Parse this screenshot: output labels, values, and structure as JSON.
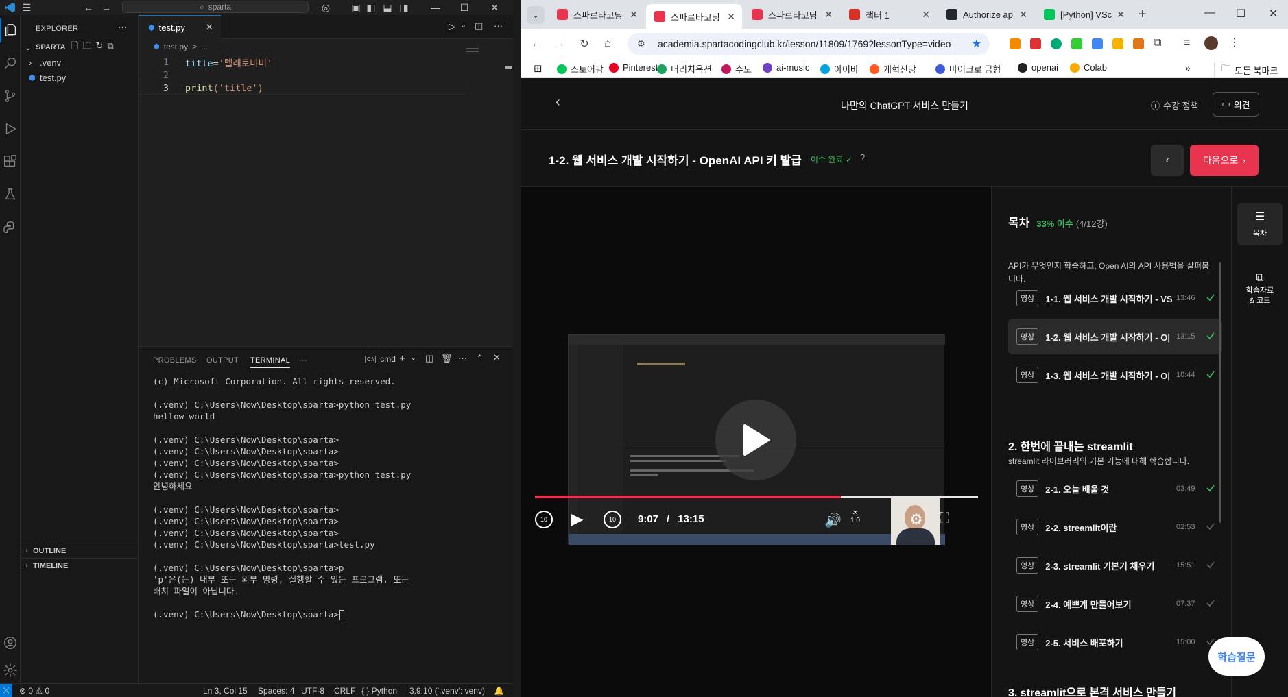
{
  "vscode": {
    "title_search": "sparta",
    "explorer": {
      "header": "EXPLORER",
      "root": "SPARTA",
      "items": [
        {
          "name": ".venv",
          "type": "folder"
        },
        {
          "name": "test.py",
          "type": "file"
        }
      ],
      "outline": "OUTLINE",
      "timeline": "TIMELINE"
    },
    "tab": {
      "label": "test.py"
    },
    "breadcrumb": {
      "file": "test.py",
      "sep": ">",
      "more": "..."
    },
    "code": [
      {
        "num": "1",
        "var": "title",
        "op": "=",
        "str": "'텔레토비비'"
      },
      {
        "num": "2"
      },
      {
        "num": "3",
        "fn": "print",
        "args": "('title')"
      }
    ],
    "panel": {
      "tabs": [
        "PROBLEMS",
        "OUTPUT",
        "TERMINAL",
        "···"
      ],
      "active_tab": "TERMINAL",
      "shell": "cmd",
      "terminal_lines": [
        "(c) Microsoft Corporation. All rights reserved.",
        "",
        "(.venv) C:\\Users\\Now\\Desktop\\sparta>python test.py",
        "hellow world",
        "",
        "(.venv) C:\\Users\\Now\\Desktop\\sparta>",
        "(.venv) C:\\Users\\Now\\Desktop\\sparta>",
        "(.venv) C:\\Users\\Now\\Desktop\\sparta>",
        "(.venv) C:\\Users\\Now\\Desktop\\sparta>python test.py",
        "안녕하세요",
        "",
        "(.venv) C:\\Users\\Now\\Desktop\\sparta>",
        "(.venv) C:\\Users\\Now\\Desktop\\sparta>",
        "(.venv) C:\\Users\\Now\\Desktop\\sparta>",
        "(.venv) C:\\Users\\Now\\Desktop\\sparta>test.py",
        "",
        "(.venv) C:\\Users\\Now\\Desktop\\sparta>p",
        "'p'은(는) 내부 또는 외부 명령, 실행할 수 있는 프로그램, 또는",
        "배치 파일이 아닙니다.",
        "",
        "(.venv) C:\\Users\\Now\\Desktop\\sparta>"
      ]
    },
    "status": {
      "errors": "⊗ 0 ⚠ 0",
      "position": "Ln 3, Col 15",
      "spaces": "Spaces: 4",
      "encoding": "UTF-8",
      "eol": "CRLF",
      "language": "{ } Python",
      "interpreter": "3.9.10 ('.venv': venv)"
    }
  },
  "chrome": {
    "tabs": [
      {
        "label": "스파르타코딩",
        "favicon_color": "#e8344e",
        "active": false
      },
      {
        "label": "스파르타코딩",
        "favicon_color": "#e8344e",
        "active": true
      },
      {
        "label": "스파르타코딩",
        "favicon_color": "#e8344e",
        "active": false
      },
      {
        "label": "챕터 1",
        "favicon_color": "#d93025",
        "active": false
      },
      {
        "label": "Authorize ap",
        "favicon_color": "#24292f",
        "active": false
      },
      {
        "label": "[Python] VSc",
        "favicon_color": "#03c75a",
        "active": false
      }
    ],
    "url": "academia.spartacodingclub.kr/lesson/11809/1769?lessonType=video",
    "bookmarks": [
      {
        "label": "스토어팜",
        "color": "#03c75a"
      },
      {
        "label": "Pinterest",
        "color": "#e60023"
      },
      {
        "label": "더리치옥션",
        "color": "#1aa260"
      },
      {
        "label": "수노",
        "color": "#c2185b"
      },
      {
        "label": "ai-music",
        "color": "#6f42c1"
      },
      {
        "label": "아이바",
        "color": "#00a3e0"
      },
      {
        "label": "개혁신당",
        "color": "#ff5a1f"
      },
      {
        "label": "마이크로 금형",
        "color": "#3b5bdb"
      },
      {
        "label": "openai",
        "color": "#222222"
      },
      {
        "label": "Colab",
        "color": "#f9ab00"
      }
    ],
    "all_bookmarks": "모든 북마크"
  },
  "lesson_page": {
    "course_title": "나만의 ChatGPT 서비스 만들기",
    "policy": "수강 정책",
    "feedback": "의견",
    "lesson_title": "1-2. 웹 서비스 개발 시작하기 - OpenAI API 키 발급",
    "completion": "이수 완료 ✓",
    "next_button": "다음으로",
    "video": {
      "current_time": "9:07",
      "separator": "/",
      "duration": "13:15",
      "progress": 0.69,
      "speed": "1.0"
    },
    "toc": {
      "title": "목차",
      "progress": "33% 이수",
      "count": "(4/12강)",
      "intro": "API가 무엇인지 학습하고, Open AI의 API 사용법을 살펴봅니다.",
      "lessons": [
        {
          "badge": "영상",
          "title": "1-1. 웹 서비스 개발 시작하기 - VS",
          "duration": "13:46",
          "done": true,
          "active": false
        },
        {
          "badge": "영상",
          "title": "1-2. 웹 서비스 개발 시작하기 - O|",
          "duration": "13:15",
          "done": true,
          "active": true
        },
        {
          "badge": "영상",
          "title": "1-3. 웹 서비스 개발 시작하기 - O|",
          "duration": "10:44",
          "done": true,
          "active": false
        }
      ],
      "section2_title": "2. 한번에 끝내는 streamlit",
      "section2_desc": "streamlit 라이브러리의 기본 기능에 대해 학습합니다.",
      "section2_lessons": [
        {
          "badge": "영상",
          "title": "2-1. 오늘 배울 것",
          "duration": "03:49",
          "done": true
        },
        {
          "badge": "영상",
          "title": "2-2. streamlit이란",
          "duration": "02:53",
          "done": false
        },
        {
          "badge": "영상",
          "title": "2-3. streamlit 기본기 채우기",
          "duration": "15:51",
          "done": false
        },
        {
          "badge": "영상",
          "title": "2-4. 예쁘게 만들어보기",
          "duration": "07:37",
          "done": false
        },
        {
          "badge": "영상",
          "title": "2-5. 서비스 배포하기",
          "duration": "15:00",
          "done": false
        }
      ],
      "section3_title": "3. streamlit으로 본격 서비스 만들기"
    },
    "rail": {
      "toc_label": "목차",
      "materials_label": "학습자료 & 코드"
    },
    "help_bubble": "학습질문"
  }
}
